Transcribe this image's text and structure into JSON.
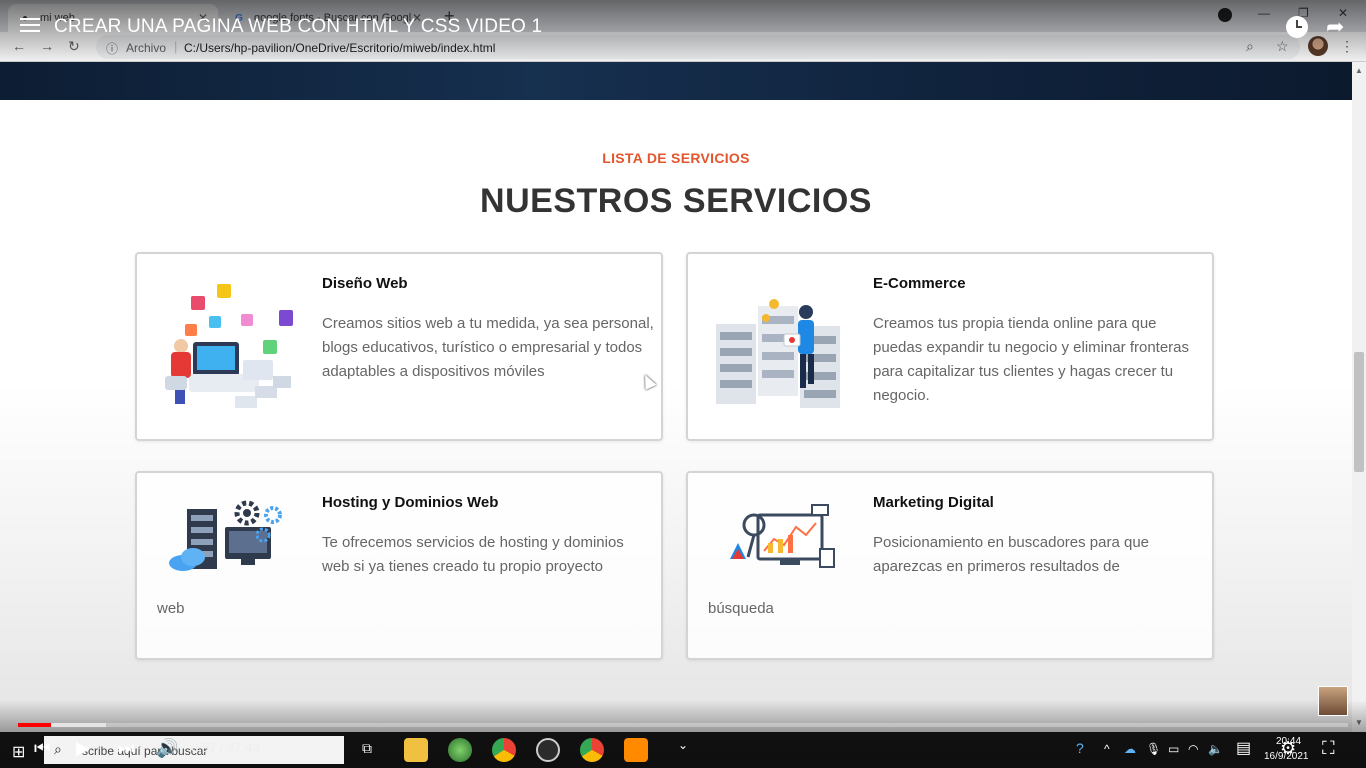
{
  "browser": {
    "tabs": [
      {
        "title": "mi web",
        "active": true
      },
      {
        "title": "google fonts - Buscar con Googl",
        "active": false
      }
    ],
    "new_tab": "+",
    "security_label": "Archivo",
    "url": "C:/Users/hp-pavilion/OneDrive/Escritorio/miweb/index.html"
  },
  "video": {
    "title": "CREAR UNA PAGINA WEB CON HTML Y CSS VIDEO 1",
    "time": "0:57 / 37:43",
    "played_fraction": 0.025,
    "loaded_fraction": 0.066
  },
  "page": {
    "subtitle": "LISTA DE SERVICIOS",
    "heading": "NUESTROS SERVICIOS",
    "services": [
      {
        "title": "Diseño Web",
        "text": "Creamos sitios web a tu medida, ya sea personal, blogs educativos, turístico o empresarial y todos adaptables a dispositivos móviles",
        "tail": "",
        "icon": "web-design-illustration"
      },
      {
        "title": "E-Commerce",
        "text": "Creamos tus propia tienda online para que puedas expandir tu negocio y eliminar fronteras para capitalizar tus clientes y hagas crecer tu negocio.",
        "tail": "",
        "icon": "ecommerce-server-illustration"
      },
      {
        "title": "Hosting y Dominios Web",
        "text": "Te ofrecemos servicios de hosting y dominios web si ya tienes creado tu propio proyecto",
        "tail": "web",
        "icon": "hosting-illustration"
      },
      {
        "title": "Marketing Digital",
        "text": "Posicionamiento en buscadores para que aparezcas en primeros resultados de",
        "tail": "búsqueda",
        "icon": "marketing-analytics-illustration"
      }
    ]
  },
  "taskbar": {
    "search_placeholder": "scribe aquí para buscar",
    "time": "20:44",
    "date": "16/9/2021"
  },
  "colors": {
    "accent": "#e2552d",
    "heading": "#333333",
    "hero": "#10233d",
    "progress": "#ff0000"
  }
}
